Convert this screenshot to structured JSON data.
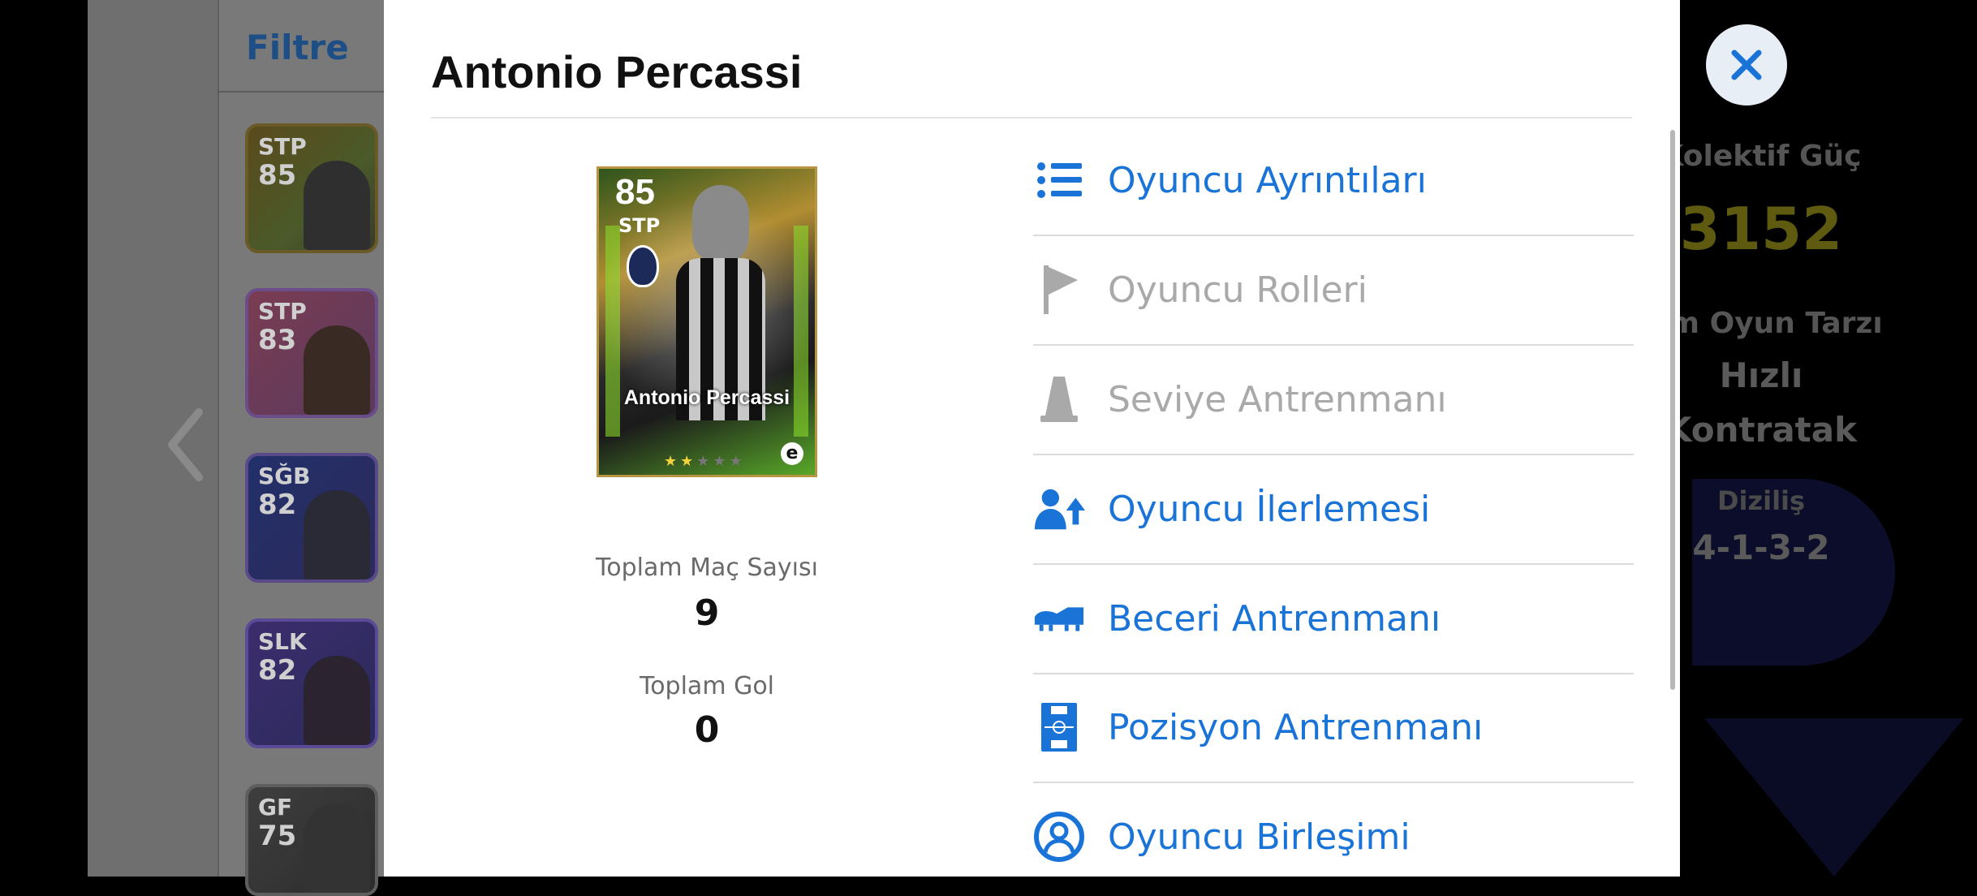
{
  "background": {
    "filter_label": "Filtre",
    "squad_cards": [
      {
        "position": "STP",
        "rating": "85"
      },
      {
        "position": "STP",
        "rating": "83"
      },
      {
        "position": "SĞB",
        "rating": "82"
      },
      {
        "position": "SLK",
        "rating": "82"
      },
      {
        "position": "GF",
        "rating": "75"
      }
    ],
    "collective_strength_label": "Kolektif Güç",
    "collective_strength_value": "3152",
    "team_playstyle_label": "kım Oyun Tarzı",
    "team_playstyle_value_line1": "Hızlı",
    "team_playstyle_value_line2": "Kontratak",
    "formation_label": "Diziliş",
    "formation_value": "4-1-3-2"
  },
  "modal": {
    "title": "Antonio Percassi",
    "close_icon": "close-icon",
    "card": {
      "rating": "85",
      "position": "STP",
      "name": "Antonio Percassi",
      "stars_filled": 2,
      "stars_total": 5,
      "brand_mark": "e"
    },
    "stats": {
      "matches_label": "Toplam Maç Sayısı",
      "matches_value": "9",
      "goals_label": "Toplam Gol",
      "goals_value": "0"
    },
    "menu": [
      {
        "label": "Oyuncu Ayrıntıları",
        "icon": "list-icon",
        "enabled": true
      },
      {
        "label": "Oyuncu Rolleri",
        "icon": "flag-icon",
        "enabled": false
      },
      {
        "label": "Seviye Antrenmanı",
        "icon": "training-cone-icon",
        "enabled": false
      },
      {
        "label": "Oyuncu İlerlemesi",
        "icon": "player-progress-icon",
        "enabled": true
      },
      {
        "label": "Beceri Antrenmanı",
        "icon": "boot-icon",
        "enabled": true
      },
      {
        "label": "Pozisyon Antrenmanı",
        "icon": "pitch-icon",
        "enabled": true
      },
      {
        "label": "Oyuncu Birleşimi",
        "icon": "player-combine-icon",
        "enabled": true
      }
    ]
  },
  "colors": {
    "accent": "#1a74d8",
    "disabled": "#a9a9a9"
  }
}
